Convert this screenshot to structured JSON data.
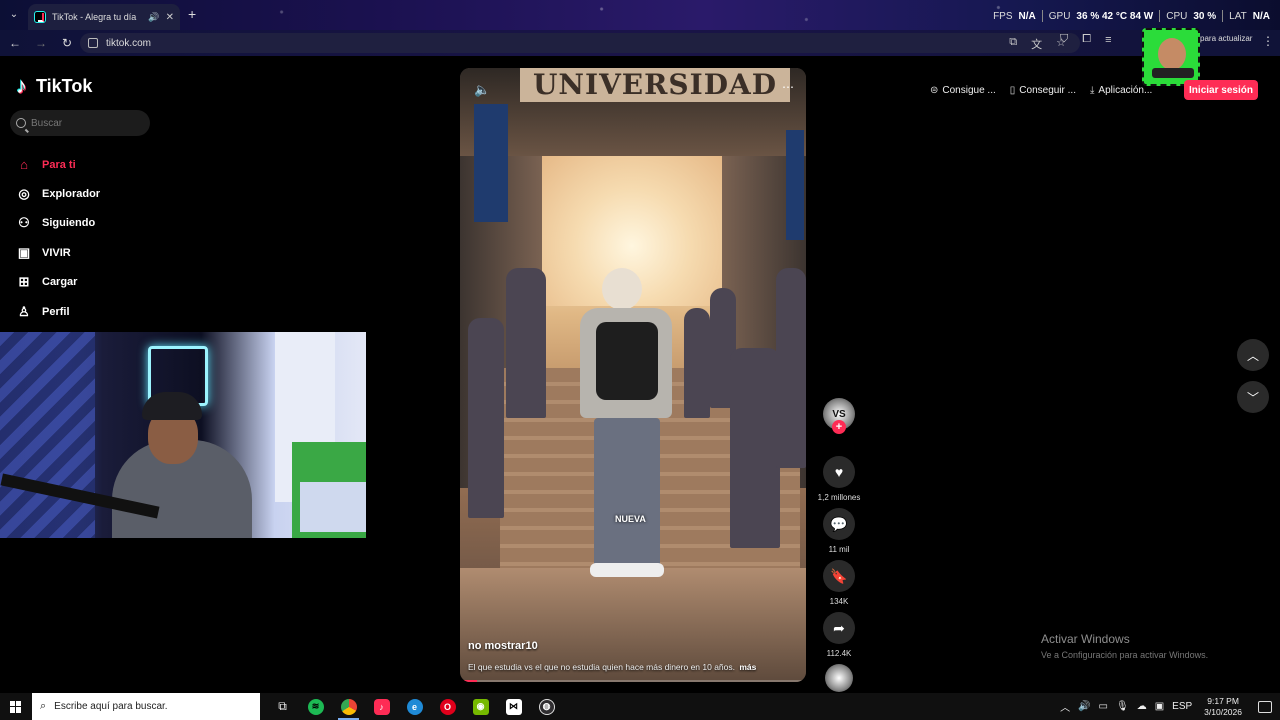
{
  "browser": {
    "tab_title": "TikTok - Alegra tu día",
    "url": "tiktok.com",
    "update_label": "para actualizar"
  },
  "hud": {
    "fps_label": "FPS",
    "fps_value": "N/A",
    "gpu_label": "GPU",
    "gpu_value": "36 % 42 °C 84 W",
    "cpu_label": "CPU",
    "cpu_value": "30 %",
    "lat_label": "LAT",
    "lat_value": "N/A"
  },
  "tiktok": {
    "logo": "TikTok",
    "search_placeholder": "Buscar",
    "nav": [
      {
        "label": "Para ti",
        "icon": "home-icon",
        "active": true
      },
      {
        "label": "Explorador",
        "icon": "compass-icon"
      },
      {
        "label": "Siguiendo",
        "icon": "following-icon"
      },
      {
        "label": "VIVIR",
        "icon": "live-icon"
      },
      {
        "label": "Cargar",
        "icon": "upload-icon"
      },
      {
        "label": "Perfil",
        "icon": "profile-icon"
      }
    ],
    "top_links": {
      "coins": "Consigue ...",
      "app": "Conseguir ...",
      "download": "Aplicación..."
    },
    "login_label": "Iniciar sesión"
  },
  "video": {
    "sign_text": "UNIVERSIDAD",
    "overlay_text": "NUEVA",
    "username": "no mostrar10",
    "description": "El que estudia vs el que no estudia quien hace más dinero en 10 años.",
    "more_label": "más",
    "progress": 0.05
  },
  "actions": {
    "avatar_text": "VS",
    "likes": "1,2 millones",
    "comments": "11 mil",
    "saves": "134K",
    "shares": "112.4K"
  },
  "watermark": {
    "line1": "Activar Windows",
    "line2": "Ve a Configuración para activar Windows."
  },
  "taskbar": {
    "search_placeholder": "Escribe aquí para buscar.",
    "lang": "ESP",
    "time": "9:17 PM",
    "date": "3/10/2026"
  },
  "colors": {
    "accent": "#fe2c55",
    "teal": "#25f4ee",
    "background": "#000000"
  }
}
